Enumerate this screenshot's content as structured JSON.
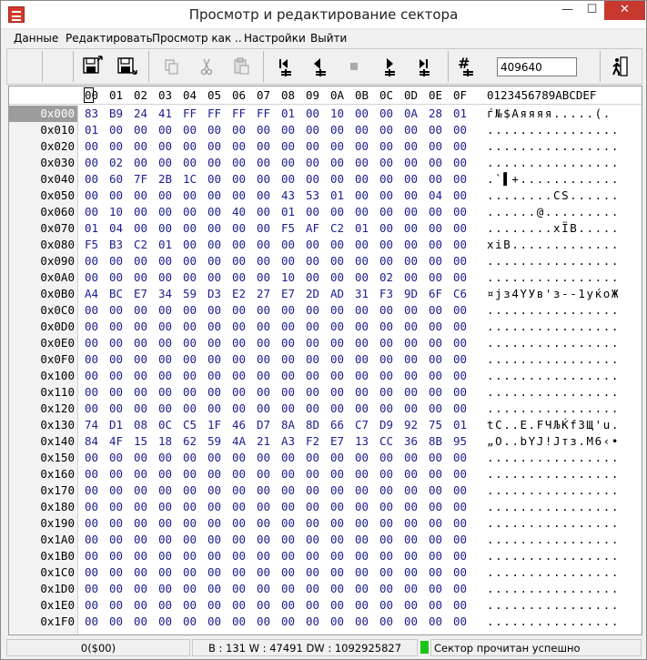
{
  "window": {
    "title": "Просмотр и редактирование сектора",
    "min_glyph": "—",
    "max_glyph": "☐",
    "close_glyph": "✕"
  },
  "menu": [
    "Данные",
    "Редактировать",
    "Просмотр как ..",
    "Настройки",
    "Выйти"
  ],
  "toolbar": {
    "sector_value": "409640",
    "icons": [
      "load-sector-icon",
      "save-sector-icon",
      "copy-icon",
      "cut-icon",
      "paste-icon",
      "first-sector-icon",
      "prev-sector-icon",
      "stop-icon",
      "next-sector-icon",
      "last-sector-icon",
      "goto-sector-icon",
      "exit-icon"
    ]
  },
  "hex": {
    "columns": [
      "00",
      "01",
      "02",
      "03",
      "04",
      "05",
      "06",
      "07",
      "08",
      "09",
      "0A",
      "0B",
      "0C",
      "0D",
      "0E",
      "0F"
    ],
    "ascii_header": "0123456789ABCDEF",
    "rows": [
      {
        "offset": "0x000",
        "bytes": "83 B9 24 41 FF FF FF FF 01 00 10 00 00 0A 28 01",
        "ascii": "ѓ№$Aяяяя.....(."
      },
      {
        "offset": "0x010",
        "bytes": "01 00 00 00 00 00 00 00 00 00 00 00 00 00 00 00",
        "ascii": "................"
      },
      {
        "offset": "0x020",
        "bytes": "00 00 00 00 00 00 00 00 00 00 00 00 00 00 00 00",
        "ascii": "................"
      },
      {
        "offset": "0x030",
        "bytes": "00 02 00 00 00 00 00 00 00 00 00 00 00 00 00 00",
        "ascii": "................"
      },
      {
        "offset": "0x040",
        "bytes": "00 60 7F 2B 1C 00 00 00 00 00 00 00 00 00 00 00",
        "ascii": ".`▌+............"
      },
      {
        "offset": "0x050",
        "bytes": "00 00 00 00 00 00 00 00 43 53 01 00 00 00 04 00",
        "ascii": "........CS......"
      },
      {
        "offset": "0x060",
        "bytes": "00 10 00 00 00 00 40 00 01 00 00 00 00 00 00 00",
        "ascii": "......@........."
      },
      {
        "offset": "0x070",
        "bytes": "01 04 00 00 00 00 00 00 F5 AF C2 01 00 00 00 00",
        "ascii": "........хЇВ....."
      },
      {
        "offset": "0x080",
        "bytes": "F5 B3 C2 01 00 00 00 00 00 00 00 00 00 00 00 00",
        "ascii": "хiВ............."
      },
      {
        "offset": "0x090",
        "bytes": "00 00 00 00 00 00 00 00 00 00 00 00 00 00 00 00",
        "ascii": "................"
      },
      {
        "offset": "0x0A0",
        "bytes": "00 00 00 00 00 00 00 00 10 00 00 00 02 00 00 00",
        "ascii": "................"
      },
      {
        "offset": "0x0B0",
        "bytes": "A4 BC E7 34 59 D3 E2 27 E7 2D AD 31 F3 9D 6F C6",
        "ascii": "¤јз4YУв'з--1уќоЖ"
      },
      {
        "offset": "0x0C0",
        "bytes": "00 00 00 00 00 00 00 00 00 00 00 00 00 00 00 00",
        "ascii": "................"
      },
      {
        "offset": "0x0D0",
        "bytes": "00 00 00 00 00 00 00 00 00 00 00 00 00 00 00 00",
        "ascii": "................"
      },
      {
        "offset": "0x0E0",
        "bytes": "00 00 00 00 00 00 00 00 00 00 00 00 00 00 00 00",
        "ascii": "................"
      },
      {
        "offset": "0x0F0",
        "bytes": "00 00 00 00 00 00 00 00 00 00 00 00 00 00 00 00",
        "ascii": "................"
      },
      {
        "offset": "0x100",
        "bytes": "00 00 00 00 00 00 00 00 00 00 00 00 00 00 00 00",
        "ascii": "................"
      },
      {
        "offset": "0x110",
        "bytes": "00 00 00 00 00 00 00 00 00 00 00 00 00 00 00 00",
        "ascii": "................"
      },
      {
        "offset": "0x120",
        "bytes": "00 00 00 00 00 00 00 00 00 00 00 00 00 00 00 00",
        "ascii": "................"
      },
      {
        "offset": "0x130",
        "bytes": "74 D1 08 0C C5 1F 46 D7 8A 8D 66 C7 D9 92 75 01",
        "ascii": "tС..Е.FЧЉЌfЗЩ'u."
      },
      {
        "offset": "0x140",
        "bytes": "84 4F 15 18 62 59 4A 21 A3 F2 E7 13 CC 36 8B 95",
        "ascii": "„O..bYJ!Јтз.М6‹•"
      },
      {
        "offset": "0x150",
        "bytes": "00 00 00 00 00 00 00 00 00 00 00 00 00 00 00 00",
        "ascii": "................"
      },
      {
        "offset": "0x160",
        "bytes": "00 00 00 00 00 00 00 00 00 00 00 00 00 00 00 00",
        "ascii": "................"
      },
      {
        "offset": "0x170",
        "bytes": "00 00 00 00 00 00 00 00 00 00 00 00 00 00 00 00",
        "ascii": "................"
      },
      {
        "offset": "0x180",
        "bytes": "00 00 00 00 00 00 00 00 00 00 00 00 00 00 00 00",
        "ascii": "................"
      },
      {
        "offset": "0x190",
        "bytes": "00 00 00 00 00 00 00 00 00 00 00 00 00 00 00 00",
        "ascii": "................"
      },
      {
        "offset": "0x1A0",
        "bytes": "00 00 00 00 00 00 00 00 00 00 00 00 00 00 00 00",
        "ascii": "................"
      },
      {
        "offset": "0x1B0",
        "bytes": "00 00 00 00 00 00 00 00 00 00 00 00 00 00 00 00",
        "ascii": "................"
      },
      {
        "offset": "0x1C0",
        "bytes": "00 00 00 00 00 00 00 00 00 00 00 00 00 00 00 00",
        "ascii": "................"
      },
      {
        "offset": "0x1D0",
        "bytes": "00 00 00 00 00 00 00 00 00 00 00 00 00 00 00 00",
        "ascii": "................"
      },
      {
        "offset": "0x1E0",
        "bytes": "00 00 00 00 00 00 00 00 00 00 00 00 00 00 00 00",
        "ascii": "................"
      },
      {
        "offset": "0x1F0",
        "bytes": "00 00 00 00 00 00 00 00 00 00 00 00 00 00 00 00",
        "ascii": "................"
      }
    ]
  },
  "status": {
    "position": "0($00)",
    "values": "B : 131 W : 47491 DW : 1092925827",
    "message": "Сектор прочитан успешно",
    "ok_color": "#19c419"
  }
}
